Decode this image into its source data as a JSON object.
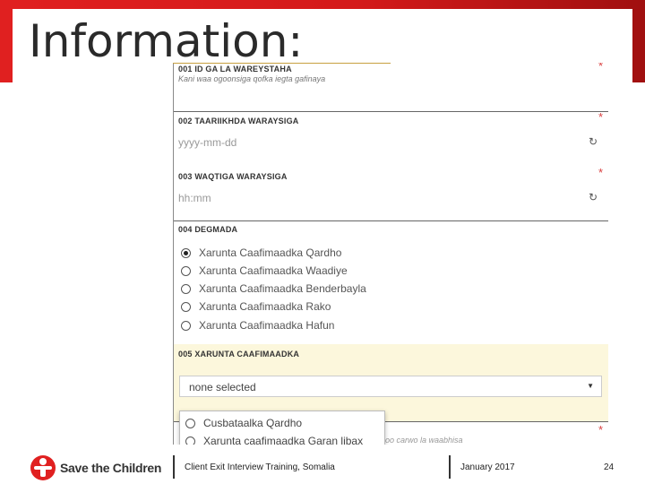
{
  "slide": {
    "title": "Information:",
    "footer_text": "Client Exit Interview Training, Somalia",
    "date": "January 2017",
    "page_number": "24",
    "logo_text": "Save the Children",
    "brand_color": "#e02020"
  },
  "form": {
    "required_marker": "*",
    "q001": {
      "label": "001 ID GA LA WAREYSTAHA",
      "hint": "Kani waa ogoonsiga qofka iegta gafinaya"
    },
    "q002": {
      "label": "002 TAARIIKHDA WARAYSIGA",
      "placeholder": "yyyy-mm-dd",
      "refresh_icon": "↻"
    },
    "q003": {
      "label": "003 WAQTIGA WARAYSIGA",
      "placeholder": "hh:mm",
      "refresh_icon": "↻"
    },
    "q004": {
      "label": "004 DEGMADA",
      "options": [
        "Xarunta Caafimaadka Qardho",
        "Xarunta Caafimaadka Waadiye",
        "Xarunta Caafimaadka Benderbayla",
        "Xarunta Caafimaadka Rako",
        "Xarunta Caafimaadka Hafun"
      ],
      "selected_index": 0
    },
    "q005": {
      "label": "005 XARUNTA CAAFIMAADKA",
      "selected_value": "none selected",
      "caret_icon": "▼",
      "dropdown_options": [
        "Cusbataalka Qardho",
        "Xarunta caafimaadka Garan libax"
      ],
      "trailing_hint": "oo carwo la waabhisa"
    }
  }
}
